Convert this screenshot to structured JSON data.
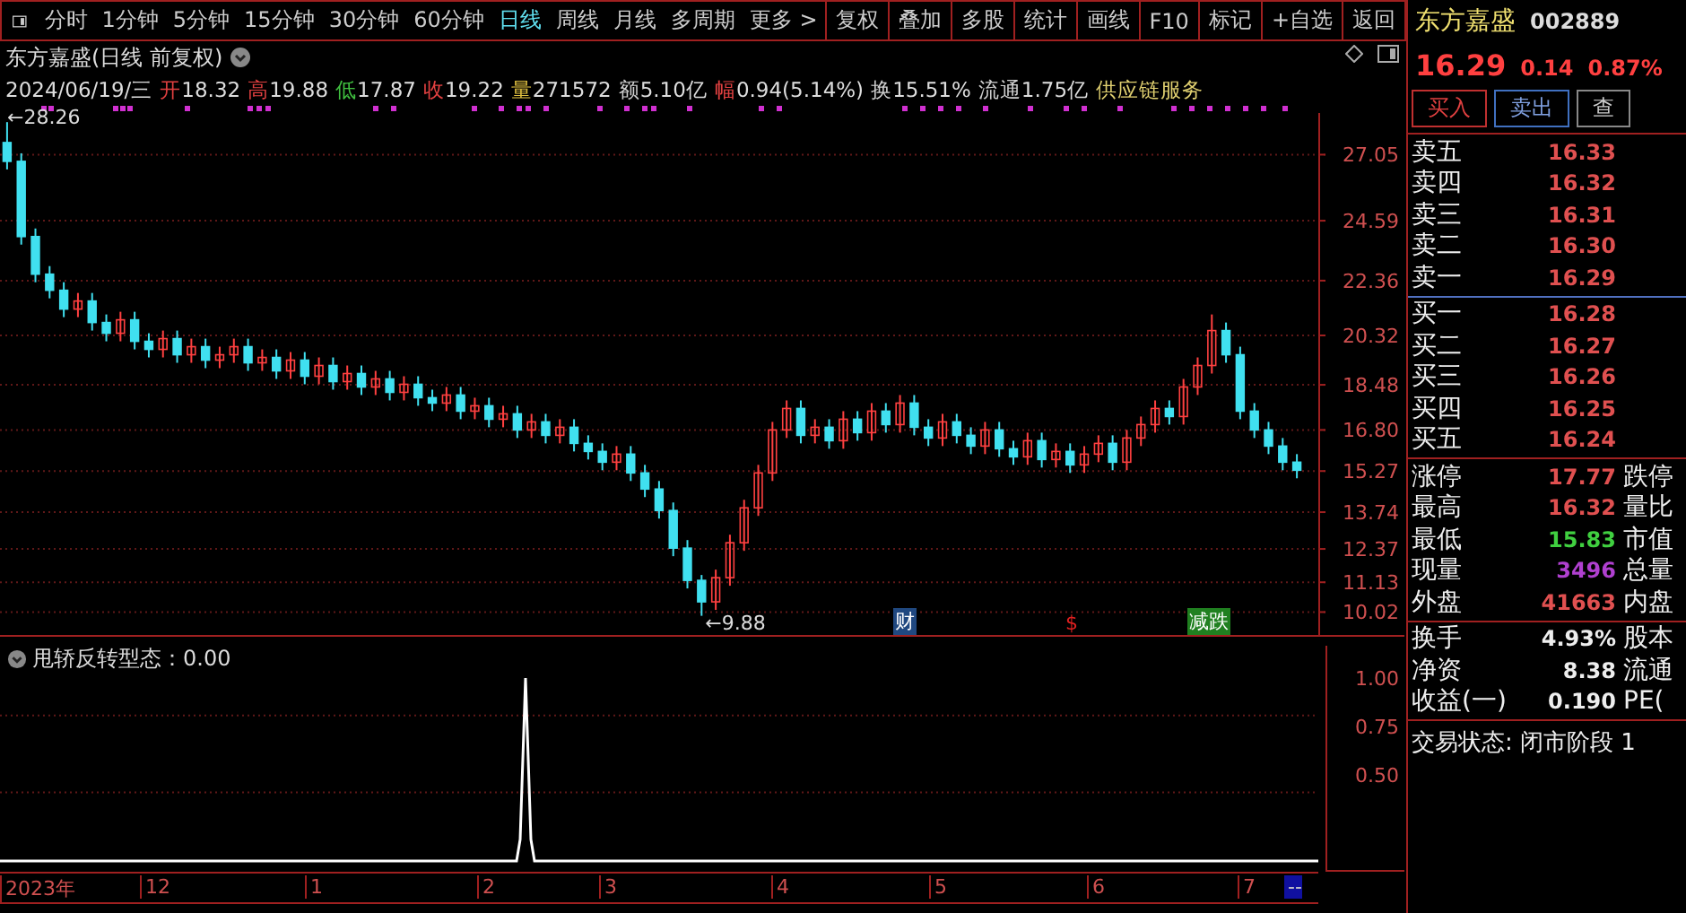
{
  "toolbar": {
    "periods": [
      {
        "label": "分时",
        "selected": false
      },
      {
        "label": "1分钟",
        "selected": false
      },
      {
        "label": "5分钟",
        "selected": false
      },
      {
        "label": "15分钟",
        "selected": false
      },
      {
        "label": "30分钟",
        "selected": false
      },
      {
        "label": "60分钟",
        "selected": false
      },
      {
        "label": "日线",
        "selected": true
      },
      {
        "label": "周线",
        "selected": false
      },
      {
        "label": "月线",
        "selected": false
      },
      {
        "label": "多周期",
        "selected": false
      }
    ],
    "more": "更多 >",
    "buttons": [
      "复权",
      "叠加",
      "多股",
      "统计",
      "画线",
      "F10",
      "标记",
      "+自选",
      "返回"
    ]
  },
  "chart_header": {
    "title": "东方嘉盛(日线 前复权)",
    "date": "2024/06/19/三",
    "quote": [
      {
        "label": "开",
        "value": "18.32",
        "color": "#e04040"
      },
      {
        "label": "高",
        "value": "19.88",
        "color": "#e04040"
      },
      {
        "label": "低",
        "value": "17.87",
        "color": "#40c040"
      },
      {
        "label": "收",
        "value": "19.22",
        "color": "#e04040"
      },
      {
        "label": "量",
        "value": "271572",
        "color": "#e0c040"
      },
      {
        "label": "额",
        "value": "5.10亿",
        "color": "#d0d0d0"
      },
      {
        "label": "幅",
        "value": "0.94(5.14%)",
        "color": "#e04040"
      },
      {
        "label": "换",
        "value": "15.51%",
        "color": "#d0d0d0"
      },
      {
        "label": "流通",
        "value": "1.75亿",
        "color": "#d0d0d0"
      }
    ],
    "sector": "供应链服务"
  },
  "main_chart": {
    "chart_data": {
      "type": "candlestick",
      "ylim": [
        9.1,
        28.6
      ],
      "grid": true,
      "yticks": [
        27.05,
        24.59,
        22.36,
        20.32,
        18.48,
        {
          "value": 16.8,
          "label": "16.80"
        },
        15.27,
        13.74,
        12.37,
        11.13,
        10.02
      ],
      "ohlc": [
        [
          27.5,
          28.26,
          26.5,
          26.8
        ],
        [
          26.8,
          27.1,
          23.7,
          24.0
        ],
        [
          24.0,
          24.3,
          22.3,
          22.6
        ],
        [
          22.6,
          22.9,
          21.7,
          22.0
        ],
        [
          22.0,
          22.3,
          21.0,
          21.3
        ],
        [
          21.3,
          21.9,
          21.0,
          21.6
        ],
        [
          21.6,
          21.9,
          20.5,
          20.8
        ],
        [
          20.8,
          21.1,
          20.1,
          20.4
        ],
        [
          20.4,
          21.2,
          20.1,
          20.9
        ],
        [
          20.9,
          21.2,
          19.8,
          20.1
        ],
        [
          20.1,
          20.4,
          19.5,
          19.8
        ],
        [
          19.8,
          20.5,
          19.5,
          20.2
        ],
        [
          20.2,
          20.5,
          19.3,
          19.6
        ],
        [
          19.6,
          20.2,
          19.3,
          19.9
        ],
        [
          19.9,
          20.2,
          19.1,
          19.4
        ],
        [
          19.4,
          19.9,
          19.1,
          19.6
        ],
        [
          19.6,
          20.2,
          19.3,
          19.9
        ],
        [
          19.9,
          20.2,
          19.0,
          19.3
        ],
        [
          19.3,
          19.8,
          19.0,
          19.5
        ],
        [
          19.5,
          19.8,
          18.7,
          19.0
        ],
        [
          19.0,
          19.7,
          18.7,
          19.4
        ],
        [
          19.4,
          19.7,
          18.5,
          18.8
        ],
        [
          18.8,
          19.5,
          18.5,
          19.2
        ],
        [
          19.2,
          19.5,
          18.3,
          18.6
        ],
        [
          18.6,
          19.2,
          18.3,
          18.9
        ],
        [
          18.9,
          19.2,
          18.1,
          18.4
        ],
        [
          18.4,
          19.0,
          18.1,
          18.7
        ],
        [
          18.7,
          19.0,
          17.9,
          18.2
        ],
        [
          18.2,
          18.8,
          17.9,
          18.5
        ],
        [
          18.5,
          18.8,
          17.7,
          18.0
        ],
        [
          18.0,
          18.3,
          17.5,
          17.8
        ],
        [
          17.8,
          18.4,
          17.5,
          18.1
        ],
        [
          18.1,
          18.4,
          17.2,
          17.5
        ],
        [
          17.5,
          18.0,
          17.2,
          17.7
        ],
        [
          17.7,
          18.0,
          16.9,
          17.2
        ],
        [
          17.2,
          17.7,
          16.9,
          17.4
        ],
        [
          17.4,
          17.7,
          16.5,
          16.8
        ],
        [
          16.8,
          17.4,
          16.5,
          17.1
        ],
        [
          17.1,
          17.4,
          16.3,
          16.6
        ],
        [
          16.6,
          17.2,
          16.3,
          16.9
        ],
        [
          16.9,
          17.2,
          16.0,
          16.3
        ],
        [
          16.3,
          16.6,
          15.7,
          16.0
        ],
        [
          16.0,
          16.3,
          15.3,
          15.6
        ],
        [
          15.6,
          16.2,
          15.3,
          15.9
        ],
        [
          15.9,
          16.2,
          14.9,
          15.2
        ],
        [
          15.2,
          15.5,
          14.3,
          14.6
        ],
        [
          14.6,
          14.9,
          13.5,
          13.8
        ],
        [
          13.8,
          14.1,
          12.1,
          12.4
        ],
        [
          12.4,
          12.7,
          10.9,
          11.2
        ],
        [
          11.2,
          11.4,
          9.88,
          10.4
        ],
        [
          10.4,
          11.6,
          10.1,
          11.3
        ],
        [
          11.3,
          12.9,
          11.0,
          12.6
        ],
        [
          12.6,
          14.2,
          12.3,
          13.9
        ],
        [
          13.9,
          15.5,
          13.6,
          15.2
        ],
        [
          15.2,
          17.1,
          14.9,
          16.8
        ],
        [
          16.8,
          17.9,
          16.5,
          17.6
        ],
        [
          17.6,
          17.9,
          16.3,
          16.6
        ],
        [
          16.6,
          17.2,
          16.3,
          16.9
        ],
        [
          16.9,
          17.2,
          16.1,
          16.4
        ],
        [
          16.4,
          17.5,
          16.1,
          17.2
        ],
        [
          17.2,
          17.5,
          16.4,
          16.7
        ],
        [
          16.7,
          17.8,
          16.4,
          17.5
        ],
        [
          17.5,
          17.8,
          16.7,
          17.0
        ],
        [
          17.0,
          18.1,
          16.7,
          17.8
        ],
        [
          17.8,
          18.1,
          16.6,
          16.9
        ],
        [
          16.9,
          17.2,
          16.2,
          16.5
        ],
        [
          16.5,
          17.4,
          16.2,
          17.1
        ],
        [
          17.1,
          17.4,
          16.3,
          16.6
        ],
        [
          16.6,
          16.9,
          15.9,
          16.2
        ],
        [
          16.2,
          17.1,
          15.9,
          16.8
        ],
        [
          16.8,
          17.1,
          15.8,
          16.1
        ],
        [
          16.1,
          16.4,
          15.5,
          15.8
        ],
        [
          15.8,
          16.7,
          15.5,
          16.4
        ],
        [
          16.4,
          16.7,
          15.4,
          15.7
        ],
        [
          15.7,
          16.3,
          15.4,
          16.0
        ],
        [
          16.0,
          16.3,
          15.2,
          15.5
        ],
        [
          15.5,
          16.2,
          15.2,
          15.9
        ],
        [
          15.9,
          16.6,
          15.6,
          16.3
        ],
        [
          16.3,
          16.6,
          15.3,
          15.6
        ],
        [
          15.6,
          16.8,
          15.3,
          16.5
        ],
        [
          16.5,
          17.3,
          16.2,
          17.0
        ],
        [
          17.0,
          17.9,
          16.7,
          17.6
        ],
        [
          17.6,
          17.9,
          17.0,
          17.3
        ],
        [
          17.3,
          18.7,
          17.0,
          18.4
        ],
        [
          18.4,
          19.5,
          18.1,
          19.2
        ],
        [
          19.2,
          21.1,
          18.9,
          20.5
        ],
        [
          20.5,
          20.8,
          19.3,
          19.6
        ],
        [
          19.6,
          19.9,
          17.2,
          17.5
        ],
        [
          17.5,
          17.8,
          16.5,
          16.8
        ],
        [
          16.8,
          17.1,
          15.9,
          16.2
        ],
        [
          16.2,
          16.5,
          15.3,
          15.6
        ],
        [
          15.6,
          15.9,
          15.0,
          15.3
        ]
      ]
    },
    "high_label": "←28.26",
    "low_label": "←9.88",
    "markers": [
      {
        "text": "财",
        "kind": "finance"
      },
      {
        "text": "$",
        "kind": "dividend"
      },
      {
        "text": "减跌",
        "kind": "limit"
      }
    ]
  },
  "indicator": {
    "title": "甩轿反转型态：0.00",
    "y_labels": [
      "1.00",
      "0.75",
      "0.50"
    ]
  },
  "x_axis": [
    "2023年",
    "12",
    "1",
    "2",
    "3",
    "4",
    "5",
    "6",
    "7",
    "--"
  ],
  "quote_panel": {
    "name": "东方嘉盛",
    "code": "002889",
    "price": "16.29",
    "change": "0.14",
    "change_pct": "0.87%",
    "actions": [
      "买入",
      "卖出",
      "查"
    ],
    "asks": [
      {
        "label": "卖五",
        "price": "16.33"
      },
      {
        "label": "卖四",
        "price": "16.32"
      },
      {
        "label": "卖三",
        "price": "16.31"
      },
      {
        "label": "卖二",
        "price": "16.30"
      },
      {
        "label": "卖一",
        "price": "16.29"
      }
    ],
    "bids": [
      {
        "label": "买一",
        "price": "16.28"
      },
      {
        "label": "买二",
        "price": "16.27"
      },
      {
        "label": "买三",
        "price": "16.26"
      },
      {
        "label": "买四",
        "price": "16.25"
      },
      {
        "label": "买五",
        "price": "16.24"
      }
    ],
    "stats": [
      {
        "label": "涨停",
        "value": "17.77",
        "color": "#e05050",
        "label2": "跌停"
      },
      {
        "label": "最高",
        "value": "16.32",
        "color": "#e05050",
        "label2": "量比"
      },
      {
        "label": "最低",
        "value": "15.83",
        "color": "#40d040",
        "label2": "市值"
      },
      {
        "label": "现量",
        "value": "3496",
        "color": "#b040d0",
        "label2": "总量"
      },
      {
        "label": "外盘",
        "value": "41663",
        "color": "#e05050",
        "label2": "内盘"
      }
    ],
    "finance": [
      {
        "label": "换手",
        "value": "4.93%",
        "label2": "股本"
      },
      {
        "label": "净资",
        "value": "8.38",
        "label2": "流通"
      },
      {
        "label": "收益(一)",
        "value": "0.190",
        "label2": "PE("
      }
    ],
    "status": "交易状态: 闭市阶段 1"
  }
}
